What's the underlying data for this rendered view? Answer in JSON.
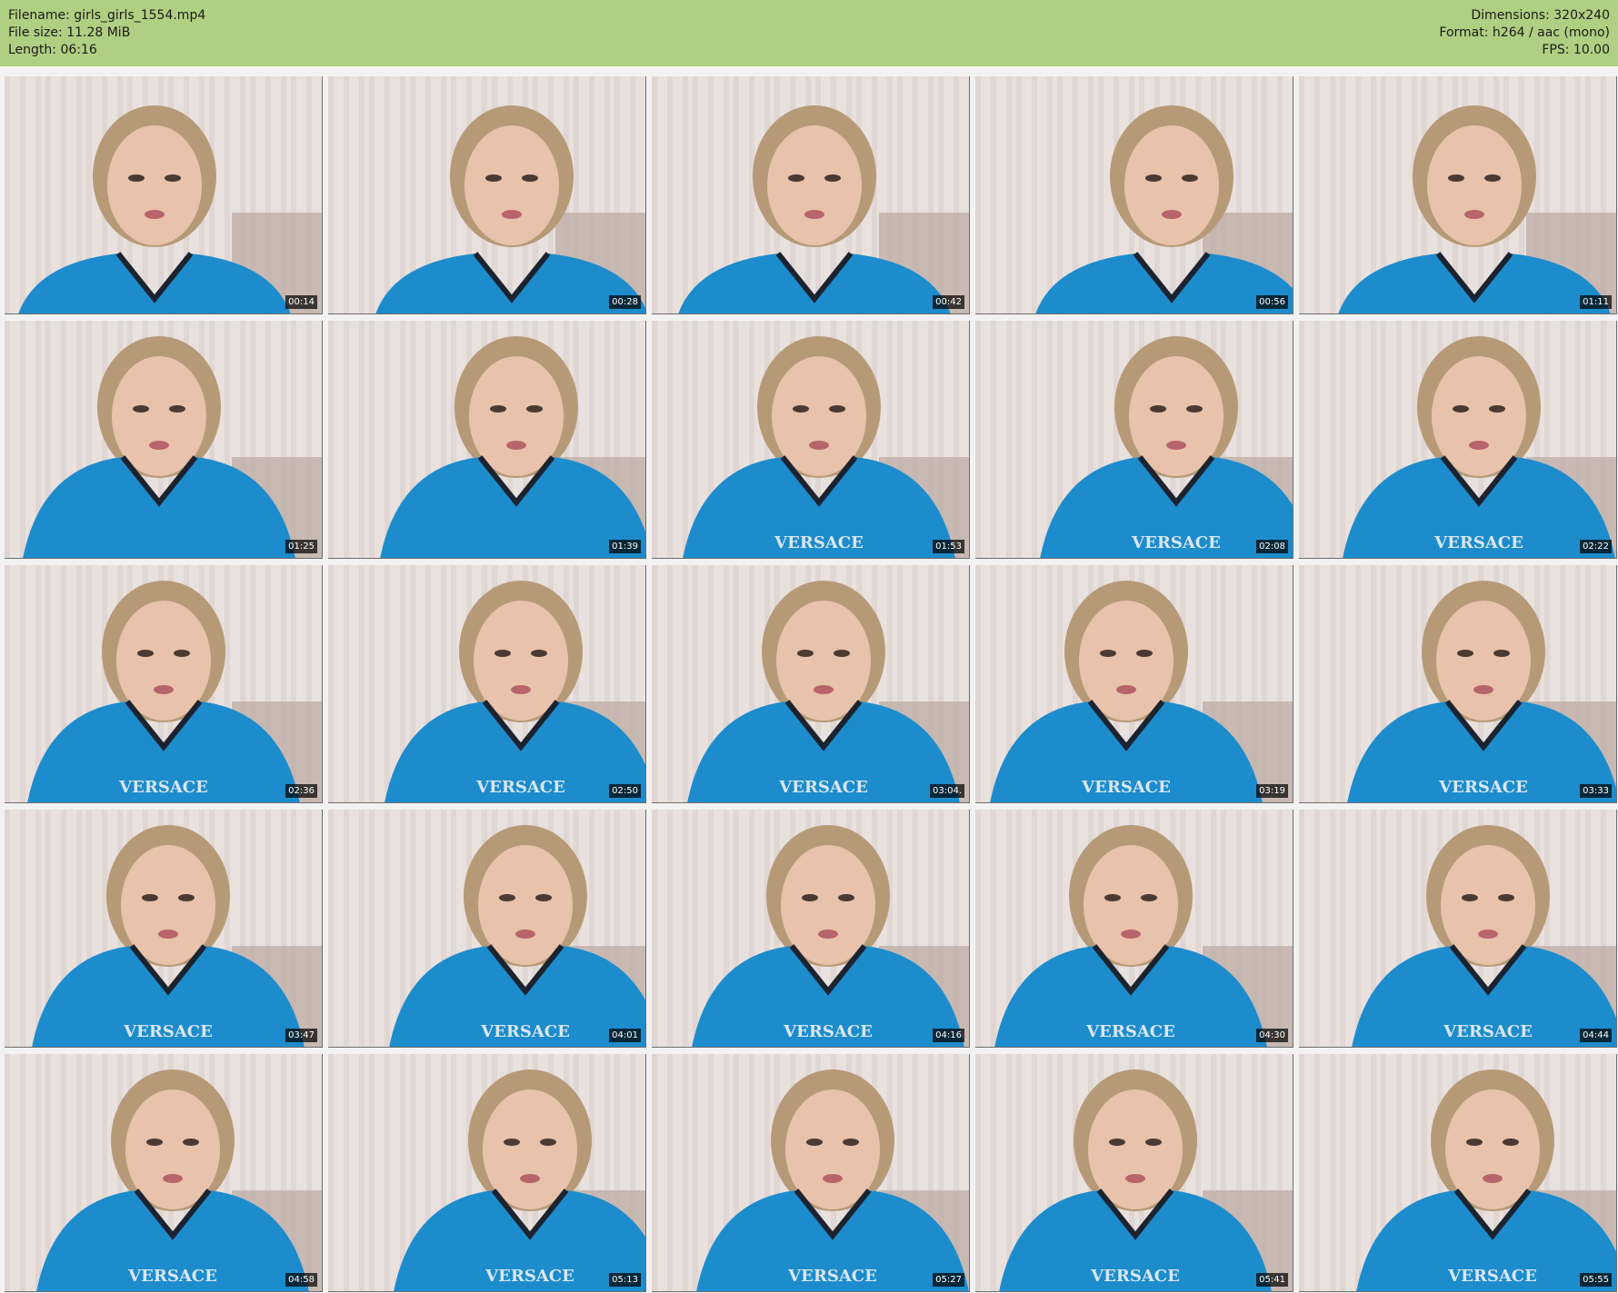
{
  "header": {
    "filename": "Filename: girls_girls_1554.mp4",
    "file_size": "File size: 11.28 MiB",
    "length": "Length: 06:16",
    "dimensions": "Dimensions: 320x240",
    "format": "Format: h264 / aac (mono)",
    "fps": "FPS: 10.00",
    "background_color": "#b0cf82"
  },
  "thumbnails": [
    {
      "timestamp": "00:14"
    },
    {
      "timestamp": "00:28"
    },
    {
      "timestamp": "00:42"
    },
    {
      "timestamp": "00:56"
    },
    {
      "timestamp": "01:11"
    },
    {
      "timestamp": "01:25"
    },
    {
      "timestamp": "01:39"
    },
    {
      "timestamp": "01:53"
    },
    {
      "timestamp": "02:08"
    },
    {
      "timestamp": "02:22"
    },
    {
      "timestamp": "02:36"
    },
    {
      "timestamp": "02:50"
    },
    {
      "timestamp": "03:04."
    },
    {
      "timestamp": "03:19"
    },
    {
      "timestamp": "03:33"
    },
    {
      "timestamp": "03:47"
    },
    {
      "timestamp": "04:01"
    },
    {
      "timestamp": "04:16"
    },
    {
      "timestamp": "04:30"
    },
    {
      "timestamp": "04:44"
    },
    {
      "timestamp": "04:58"
    },
    {
      "timestamp": "05:13"
    },
    {
      "timestamp": "05:27"
    },
    {
      "timestamp": "05:41"
    },
    {
      "timestamp": "05:55"
    }
  ],
  "shirt_text": "VERSACE",
  "colors": {
    "shirt": "#1c8ccd",
    "curtain": "#e9e1de",
    "hair": "#b69a78",
    "skin": "#e8c2ab"
  }
}
